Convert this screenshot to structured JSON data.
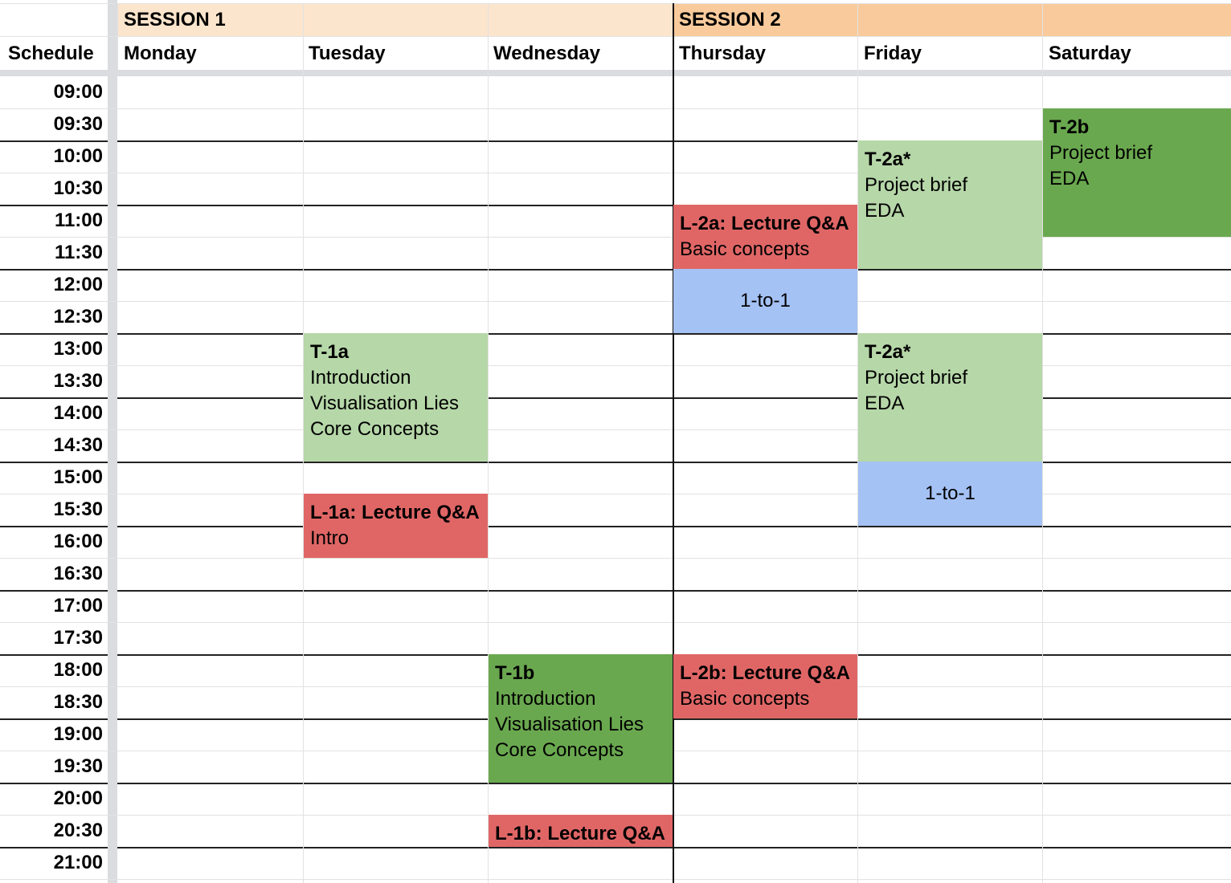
{
  "colors": {
    "session1_header": "#fce5cd",
    "session2_header": "#f9cb9c",
    "tutorial_light": "#b6d7a8",
    "tutorial_dark": "#6aa84f",
    "lecture": "#e06666",
    "one_to_one": "#a4c2f4"
  },
  "header": {
    "sessions": [
      {
        "label": "SESSION 1"
      },
      {
        "label": "SESSION 2"
      }
    ],
    "corner_label": "Schedule",
    "days": [
      "Monday",
      "Tuesday",
      "Wednesday",
      "Thursday",
      "Friday",
      "Saturday"
    ]
  },
  "times": [
    "09:00",
    "09:30",
    "10:00",
    "10:30",
    "11:00",
    "11:30",
    "12:00",
    "12:30",
    "13:00",
    "13:30",
    "14:00",
    "14:30",
    "15:00",
    "15:30",
    "16:00",
    "16:30",
    "17:00",
    "17:30",
    "18:00",
    "18:30",
    "19:00",
    "19:30",
    "20:00",
    "20:30",
    "21:00"
  ],
  "events": [
    {
      "id": "T-2b",
      "kind": "tutorial_dark",
      "day": 5,
      "start": "09:30",
      "end": "11:30",
      "lines": [
        {
          "text": "T-2b",
          "bold": true
        },
        {
          "text": "Project brief"
        },
        {
          "text": "EDA"
        }
      ]
    },
    {
      "id": "T-2a-am",
      "kind": "tutorial_light",
      "day": 4,
      "start": "10:00",
      "end": "12:00",
      "lines": [
        {
          "text": "T-2a*",
          "bold": true
        },
        {
          "text": "Project brief"
        },
        {
          "text": "EDA"
        }
      ]
    },
    {
      "id": "L-2a",
      "kind": "lecture",
      "day": 3,
      "start": "11:00",
      "end": "12:00",
      "lines": [
        {
          "text": "L-2a: Lecture Q&A",
          "bold": true
        },
        {
          "text": "Basic concepts"
        }
      ]
    },
    {
      "id": "one-to-one-thu",
      "kind": "one_to_one",
      "day": 3,
      "start": "12:00",
      "end": "13:00",
      "centered": true,
      "lines": [
        {
          "text": "1-to-1"
        }
      ]
    },
    {
      "id": "T-1a",
      "kind": "tutorial_light",
      "day": 1,
      "start": "13:00",
      "end": "15:00",
      "lines": [
        {
          "text": "T-1a",
          "bold": true
        },
        {
          "text": "Introduction"
        },
        {
          "text": "Visualisation Lies"
        },
        {
          "text": "Core Concepts"
        }
      ]
    },
    {
      "id": "T-2a-pm",
      "kind": "tutorial_light",
      "day": 4,
      "start": "13:00",
      "end": "15:00",
      "lines": [
        {
          "text": "T-2a*",
          "bold": true
        },
        {
          "text": "Project brief"
        },
        {
          "text": "EDA"
        }
      ]
    },
    {
      "id": "one-to-one-fri",
      "kind": "one_to_one",
      "day": 4,
      "start": "15:00",
      "end": "16:00",
      "centered": true,
      "lines": [
        {
          "text": "1-to-1"
        }
      ]
    },
    {
      "id": "L-1a",
      "kind": "lecture",
      "day": 1,
      "start": "15:30",
      "end": "16:30",
      "lines": [
        {
          "text": "L-1a: Lecture Q&A",
          "bold": true
        },
        {
          "text": "Intro"
        }
      ]
    },
    {
      "id": "T-1b",
      "kind": "tutorial_dark",
      "day": 2,
      "start": "18:00",
      "end": "20:00",
      "lines": [
        {
          "text": "T-1b",
          "bold": true
        },
        {
          "text": "Introduction"
        },
        {
          "text": "Visualisation Lies"
        },
        {
          "text": "Core Concepts"
        }
      ]
    },
    {
      "id": "L-2b",
      "kind": "lecture",
      "day": 3,
      "start": "18:00",
      "end": "19:00",
      "lines": [
        {
          "text": "L-2b: Lecture Q&A",
          "bold": true
        },
        {
          "text": "Basic concepts"
        }
      ]
    },
    {
      "id": "L-1b",
      "kind": "lecture",
      "day": 2,
      "start": "20:30",
      "end": "21:00",
      "lines": [
        {
          "text": "L-1b: Lecture Q&A",
          "bold": true
        }
      ]
    }
  ]
}
